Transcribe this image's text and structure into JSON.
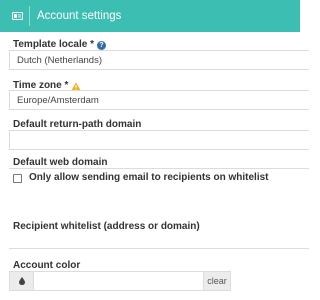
{
  "header": {
    "title": "Account settings",
    "icon": "id-card-icon",
    "background_color": "#3dbeb3"
  },
  "fields": {
    "template_locale": {
      "label": "Template locale *",
      "value": "Dutch (Netherlands)",
      "icon": "help-icon"
    },
    "time_zone": {
      "label": "Time zone *",
      "value": "Europe/Amsterdam",
      "icon": "warning-icon"
    },
    "return_path_domain": {
      "label": "Default return-path domain",
      "value": ""
    },
    "web_domain": {
      "label": "Default web domain",
      "value": ""
    },
    "whitelist_only": {
      "label": "Only allow sending email to recipients on whitelist",
      "checked": false
    },
    "recipient_whitelist": {
      "label": "Recipient whitelist (address or domain)",
      "value": ""
    },
    "account_color": {
      "label": "Account color",
      "value": "",
      "clear_label": "clear",
      "icon": "color-drop-icon"
    }
  },
  "help_icon_glyph": "?",
  "warning_color": "#f0ad1e"
}
